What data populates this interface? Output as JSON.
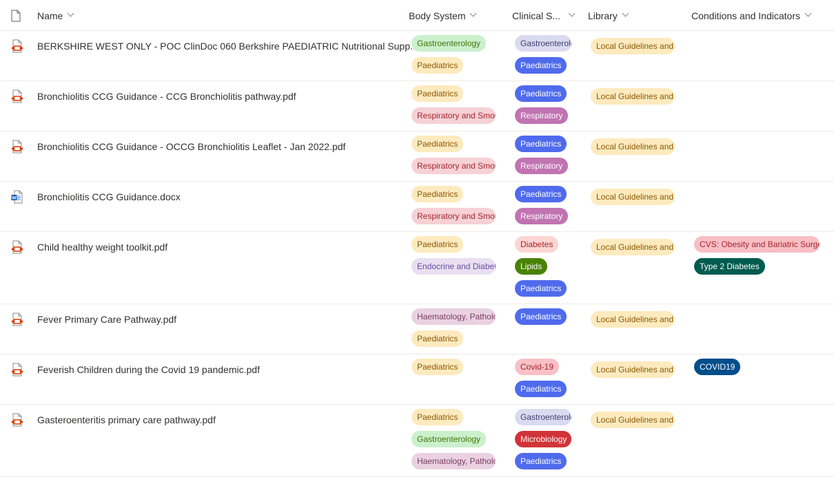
{
  "header": {
    "columns": [
      {
        "label": "Name"
      },
      {
        "label": "Body System"
      },
      {
        "label": "Clinical S..."
      },
      {
        "label": "Library"
      },
      {
        "label": "Conditions and Indicators"
      }
    ]
  },
  "colors": {
    "gastro_green": {
      "bg": "#caf0cc",
      "fg": "#437406"
    },
    "paed_yellow": {
      "bg": "#fdeabe",
      "fg": "#8a5906"
    },
    "resp_pink": {
      "bg": "#f6d1d5",
      "fg": "#a4262c"
    },
    "endo_lavender": {
      "bg": "#e8dff2",
      "fg": "#6b4d9a"
    },
    "haem_mauve": {
      "bg": "#ead1e1",
      "fg": "#7a3b65"
    },
    "gastro_lilac": {
      "bg": "#dadaf0",
      "fg": "#403e70"
    },
    "paed_blue": {
      "bg": "#4f6bed",
      "fg": "#ffffff"
    },
    "resp_purple": {
      "bg": "#c173b2",
      "fg": "#ffffff"
    },
    "diabetes_pink": {
      "bg": "#fdd5d3",
      "fg": "#a4262c"
    },
    "lipids_green": {
      "bg": "#498205",
      "fg": "#ffffff"
    },
    "micro_red": {
      "bg": "#d13438",
      "fg": "#ffffff"
    },
    "covid_pink": {
      "bg": "#f9c0c6",
      "fg": "#a4262c"
    },
    "cvs_pink": {
      "bg": "#f8bfc5",
      "fg": "#a4262c"
    },
    "t2d_teal": {
      "bg": "#005b4f",
      "fg": "#ffffff"
    },
    "covid_navy": {
      "bg": "#004e8c",
      "fg": "#ffffff"
    }
  },
  "rows": [
    {
      "name": "BERKSHIRE WEST ONLY - POC ClinDoc 060 Berkshire PAEDIATRIC Nutritional Supp...",
      "icon": "pdf-icon",
      "body_system": [
        {
          "label": "Gastroenterology",
          "color": "gastro_green"
        },
        {
          "label": "Paediatrics",
          "color": "paed_yellow"
        }
      ],
      "clinical": [
        {
          "label": "Gastroenterology",
          "color": "gastro_lilac"
        },
        {
          "label": "Paediatrics",
          "color": "paed_blue"
        }
      ],
      "library": [
        {
          "label": "Local Guidelines and Pathways",
          "color": "paed_yellow"
        }
      ],
      "conditions": []
    },
    {
      "name": "Bronchiolitis CCG Guidance - CCG Bronchiolitis pathway.pdf",
      "icon": "pdf-icon",
      "body_system": [
        {
          "label": "Paediatrics",
          "color": "paed_yellow"
        },
        {
          "label": "Respiratory and Smoking",
          "color": "resp_pink"
        }
      ],
      "clinical": [
        {
          "label": "Paediatrics",
          "color": "paed_blue"
        },
        {
          "label": "Respiratory",
          "color": "resp_purple"
        }
      ],
      "library": [
        {
          "label": "Local Guidelines and Pathways",
          "color": "paed_yellow"
        }
      ],
      "conditions": []
    },
    {
      "name": "Bronchiolitis CCG Guidance - OCCG Bronchiolitis Leaflet - Jan 2022.pdf",
      "icon": "pdf-icon",
      "body_system": [
        {
          "label": "Paediatrics",
          "color": "paed_yellow"
        },
        {
          "label": "Respiratory and Smoking",
          "color": "resp_pink"
        }
      ],
      "clinical": [
        {
          "label": "Paediatrics",
          "color": "paed_blue"
        },
        {
          "label": "Respiratory",
          "color": "resp_purple"
        }
      ],
      "library": [
        {
          "label": "Local Guidelines and Pathways",
          "color": "paed_yellow"
        }
      ],
      "conditions": []
    },
    {
      "name": "Bronchiolitis CCG Guidance.docx",
      "icon": "word-icon",
      "body_system": [
        {
          "label": "Paediatrics",
          "color": "paed_yellow"
        },
        {
          "label": "Respiratory and Smoking",
          "color": "resp_pink"
        }
      ],
      "clinical": [
        {
          "label": "Paediatrics",
          "color": "paed_blue"
        },
        {
          "label": "Respiratory",
          "color": "resp_purple"
        }
      ],
      "library": [
        {
          "label": "Local Guidelines and Pathways",
          "color": "paed_yellow"
        }
      ],
      "conditions": []
    },
    {
      "name": "Child healthy weight toolkit.pdf",
      "icon": "pdf-icon",
      "body_system": [
        {
          "label": "Paediatrics",
          "color": "paed_yellow"
        },
        {
          "label": "Endocrine and Diabetes",
          "color": "endo_lavender"
        }
      ],
      "clinical": [
        {
          "label": "Diabetes",
          "color": "diabetes_pink"
        },
        {
          "label": "Lipids",
          "color": "lipids_green"
        },
        {
          "label": "Paediatrics",
          "color": "paed_blue"
        }
      ],
      "library": [
        {
          "label": "Local Guidelines and Pathways",
          "color": "paed_yellow"
        }
      ],
      "conditions": [
        {
          "label": "CVS: Obesity and Bariatric Surgery",
          "color": "cvs_pink"
        },
        {
          "label": "Type 2 Diabetes",
          "color": "t2d_teal"
        }
      ]
    },
    {
      "name": "Fever Primary Care Pathway.pdf",
      "icon": "pdf-icon",
      "body_system": [
        {
          "label": "Haematology, Pathology",
          "color": "haem_mauve"
        },
        {
          "label": "Paediatrics",
          "color": "paed_yellow"
        }
      ],
      "clinical": [
        {
          "label": "Paediatrics",
          "color": "paed_blue"
        }
      ],
      "library": [
        {
          "label": "Local Guidelines and Pathways",
          "color": "paed_yellow"
        }
      ],
      "conditions": []
    },
    {
      "name": "Feverish Children during the Covid 19 pandemic.pdf",
      "icon": "pdf-icon",
      "body_system": [
        {
          "label": "Paediatrics",
          "color": "paed_yellow"
        }
      ],
      "clinical": [
        {
          "label": "Covid-19",
          "color": "covid_pink"
        },
        {
          "label": "Paediatrics",
          "color": "paed_blue"
        }
      ],
      "library": [
        {
          "label": "Local Guidelines and Pathways",
          "color": "paed_yellow"
        }
      ],
      "conditions": [
        {
          "label": "COVID19",
          "color": "covid_navy"
        }
      ]
    },
    {
      "name": "Gasteroenteritis primary care pathway.pdf",
      "icon": "pdf-icon",
      "body_system": [
        {
          "label": "Paediatrics",
          "color": "paed_yellow"
        },
        {
          "label": "Gastroenterology",
          "color": "gastro_green"
        },
        {
          "label": "Haematology, Pathology",
          "color": "haem_mauve"
        }
      ],
      "clinical": [
        {
          "label": "Gastroenterology",
          "color": "gastro_lilac"
        },
        {
          "label": "Microbiology",
          "color": "micro_red"
        },
        {
          "label": "Paediatrics",
          "color": "paed_blue"
        }
      ],
      "library": [
        {
          "label": "Local Guidelines and Pathways",
          "color": "paed_yellow"
        }
      ],
      "conditions": []
    }
  ]
}
